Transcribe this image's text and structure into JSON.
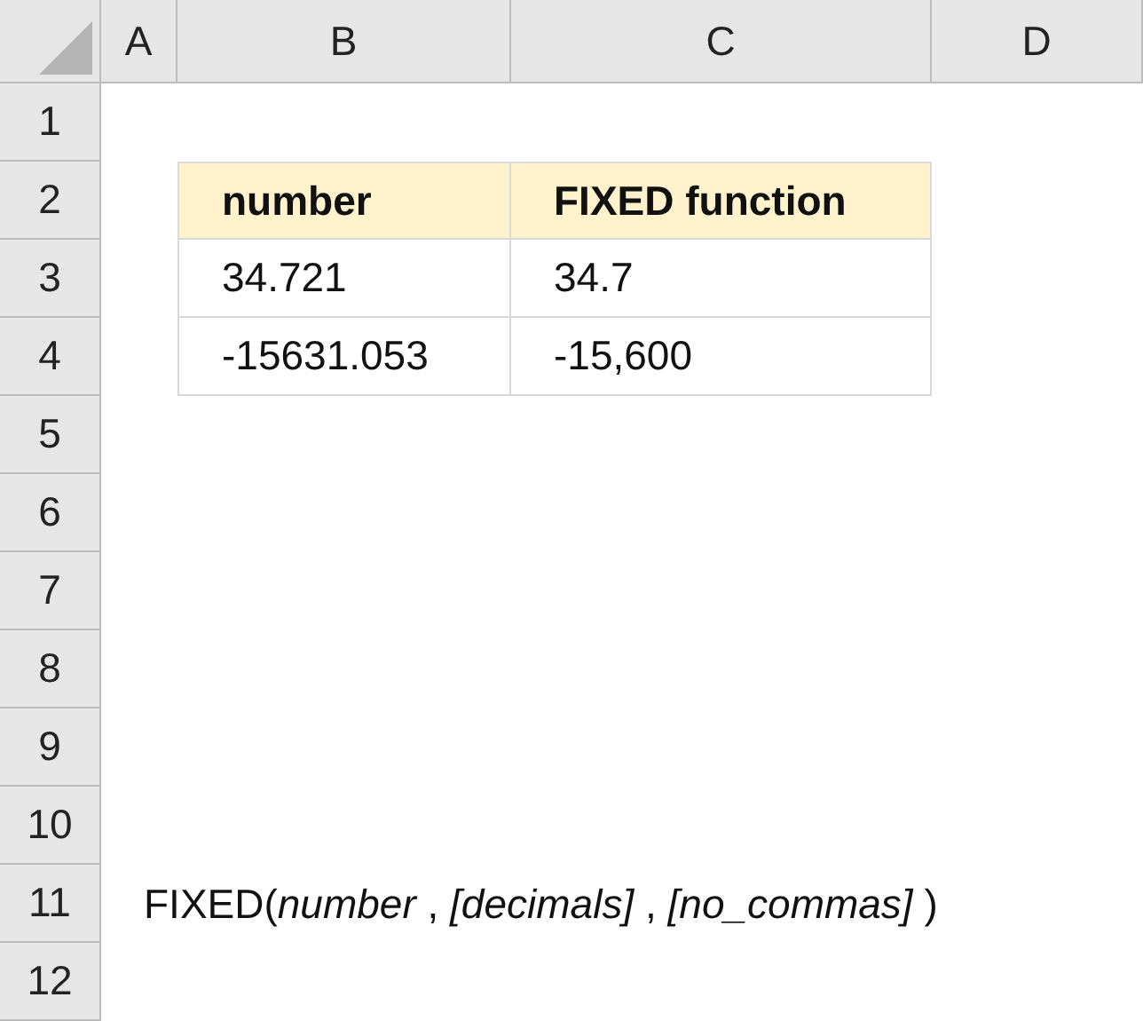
{
  "columns": [
    "A",
    "B",
    "C",
    "D"
  ],
  "rows": [
    "1",
    "2",
    "3",
    "4",
    "5",
    "6",
    "7",
    "8",
    "9",
    "10",
    "11",
    "12"
  ],
  "table": {
    "header": [
      "number",
      "FIXED function"
    ],
    "rows": [
      [
        "34.721",
        "34.7"
      ],
      [
        "-15631.053",
        "-15,600"
      ]
    ]
  },
  "syntax": "FIXED(*number* , *[decimals]* , *[no_commas]* )"
}
